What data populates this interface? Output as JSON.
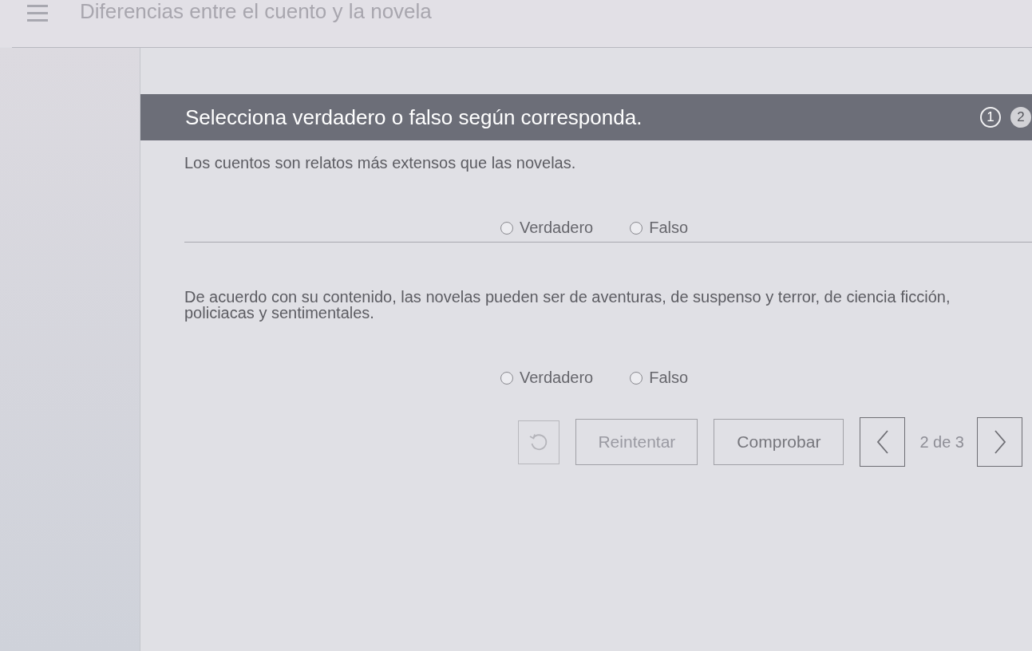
{
  "header": {
    "title": "Diferencias entre el cuento y la novela"
  },
  "activity": {
    "instruction": "Selecciona verdadero o falso según corresponda.",
    "steps": [
      {
        "label": "1",
        "selected": false
      },
      {
        "label": "2",
        "selected": true
      }
    ]
  },
  "questions": [
    {
      "text": "Los cuentos son relatos más extensos que las novelas.",
      "options": [
        {
          "label": "Verdadero",
          "selected": false
        },
        {
          "label": "Falso",
          "selected": false
        }
      ]
    },
    {
      "text": "De acuerdo con su contenido, las novelas pueden ser de aventuras, de suspenso y terror, de ciencia ficción, policiacas y sentimentales.",
      "options": [
        {
          "label": "Verdadero",
          "selected": false
        },
        {
          "label": "Falso",
          "selected": false
        }
      ]
    }
  ],
  "controls": {
    "reset": {
      "disabled": true
    },
    "retry": {
      "label": "Reintentar",
      "disabled": true
    },
    "check": {
      "label": "Comprobar",
      "disabled": false
    },
    "pager": {
      "text": "2 de 3"
    }
  }
}
